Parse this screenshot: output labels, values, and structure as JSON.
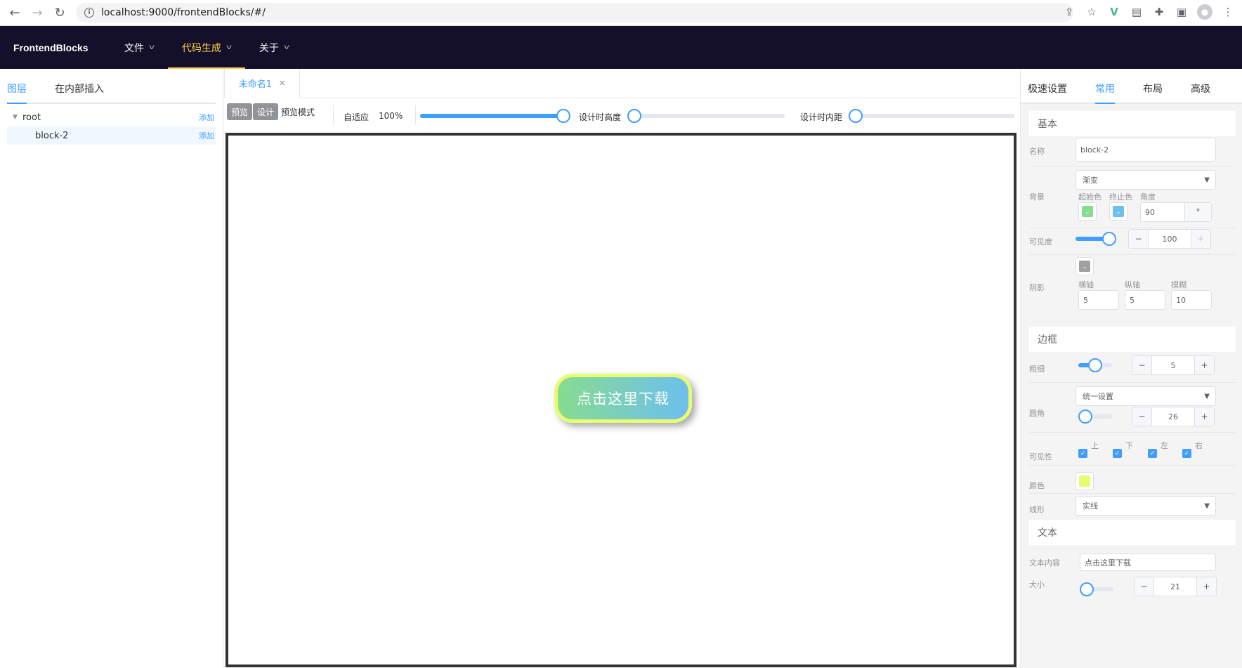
{
  "browser": {
    "url": "localhost:9000/frontendBlocks/#/"
  },
  "header": {
    "brand": "FrontendBlocks",
    "menus": [
      {
        "label": "文件"
      },
      {
        "label": "代码生成"
      },
      {
        "label": "关于"
      }
    ]
  },
  "left": {
    "tabs": [
      "图层",
      "在内部插入"
    ],
    "tree": [
      {
        "label": "root",
        "action": "添加"
      },
      {
        "label": "block-2",
        "action": "添加"
      }
    ]
  },
  "center": {
    "file_tab": "未命名1",
    "toolbar": {
      "preview_btn": "预览",
      "design_btn": "设计",
      "preview_mode": "预览模式",
      "adaptive": "自适应",
      "zoom": "100%",
      "zoom_fraction": 1.0,
      "design_height": "设计时高度",
      "design_height_fraction": 0,
      "design_padding": "设计时内距",
      "design_padding_fraction": 0
    },
    "block_text": "点击这里下载"
  },
  "right": {
    "tabs": [
      "极速设置",
      "常用",
      "布局",
      "高级"
    ],
    "basic": {
      "title": "基本",
      "name_label": "名称",
      "name_value": "block-2",
      "bg_label": "背景",
      "bg_type": "渐变",
      "start_color_label": "起始色",
      "end_color_label": "终止色",
      "angle_label": "角度",
      "angle_value": "90",
      "angle_unit": "°",
      "start_color": "#86dc8f",
      "end_color": "#6dbfef",
      "opacity_label": "可见度",
      "opacity_value": "100",
      "shadow_label": "阴影",
      "shadow_color": "#a0a0a0",
      "shadow_x_label": "横轴",
      "shadow_y_label": "纵轴",
      "shadow_blur_label": "模糊",
      "shadow_x": "5",
      "shadow_y": "5",
      "shadow_blur": "10"
    },
    "border": {
      "title": "边框",
      "width_label": "粗细",
      "width_value": "5",
      "radius_label": "圆角",
      "radius_mode": "统一设置",
      "radius_value": "26",
      "visibility_label": "可见性",
      "sides": [
        "上",
        "下",
        "左",
        "右"
      ],
      "color_label": "颜色",
      "color": "#e8fb72",
      "style_label": "线形",
      "style_value": "实线"
    },
    "text": {
      "title": "文本",
      "content_label": "文本内容",
      "content_value": "点击这里下载",
      "size_label": "大小",
      "size_value": "21"
    }
  }
}
